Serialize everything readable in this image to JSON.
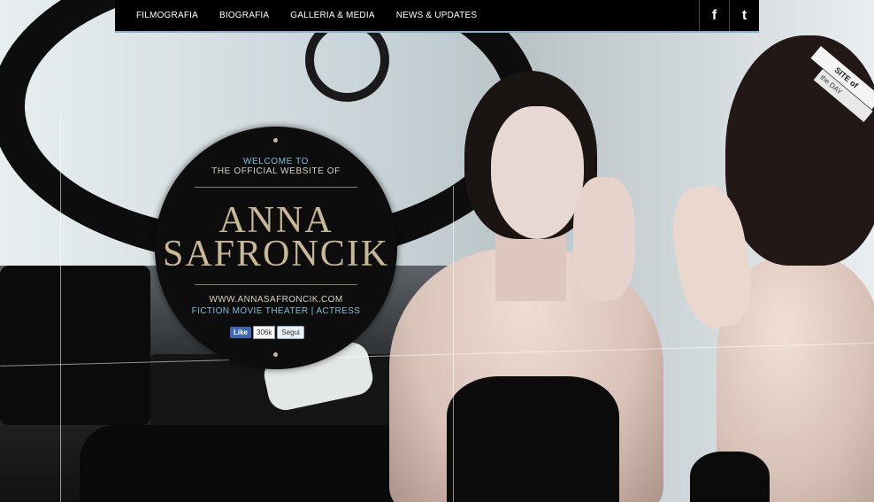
{
  "nav": {
    "items": [
      "FILMOGRAFIA",
      "BIOGRAFIA",
      "GALLERIA & MEDIA",
      "NEWS & UPDATES"
    ],
    "facebook_glyph": "f",
    "twitter_glyph": "t"
  },
  "intro": {
    "welcome": "WELCOME TO",
    "subtitle": "THE OFFICIAL WEBSITE OF",
    "first_name": "ANNA",
    "last_name": "SAFRONCIK",
    "url": "WWW.ANNASAFRONCIK.COM",
    "role": "FICTION MOVIE THEATER | ACTRESS"
  },
  "social_widgets": {
    "like_label": "Like",
    "like_count": "306k",
    "follow_label": "Segui"
  },
  "badge": {
    "line1": "SITE of",
    "line2": "the DAY"
  },
  "colors": {
    "accent": "#7cc0d4",
    "gold": "#c9b896",
    "nav_bg": "#000000"
  }
}
